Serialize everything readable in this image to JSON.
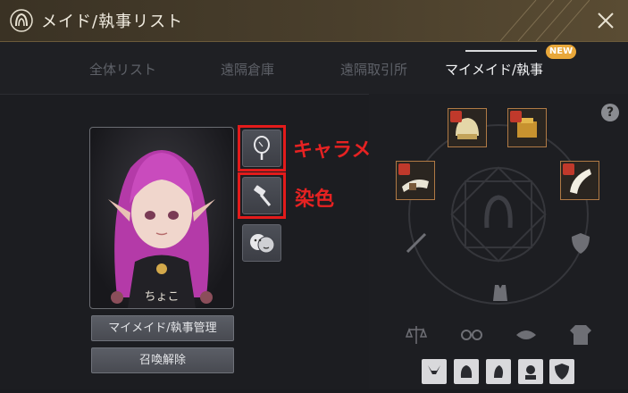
{
  "window": {
    "title": "メイド/執事リスト"
  },
  "tabs": [
    {
      "label": "全体リスト",
      "active": false
    },
    {
      "label": "遠隔倉庫",
      "active": false
    },
    {
      "label": "遠隔取引所",
      "active": false
    },
    {
      "label": "マイメイド/執事",
      "active": true,
      "badge": "NEW"
    }
  ],
  "character": {
    "name": "ちょこ"
  },
  "buttons": {
    "manage": "マイメイド/執事管理",
    "dismiss": "召喚解除"
  },
  "annotations": {
    "charamake": "キャラメイク",
    "dye": "染色"
  },
  "help": {
    "label": "?"
  },
  "colors": {
    "accent_red": "#e31b1b",
    "badge": "#e8a73a",
    "slot_border": "#b07a45"
  }
}
